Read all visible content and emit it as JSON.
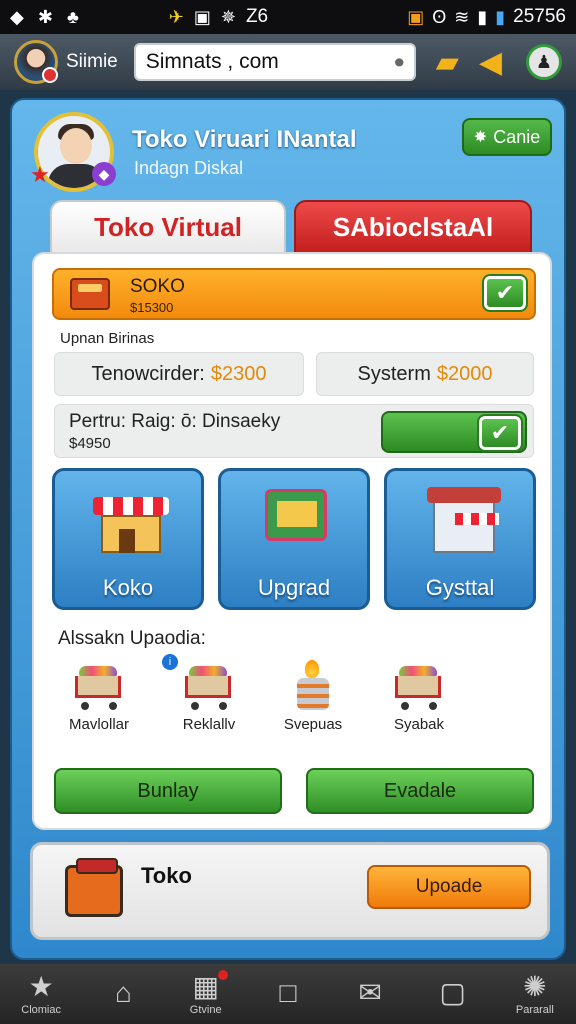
{
  "status_bar": {
    "left_icons": [
      "app-icon",
      "gear-icon",
      "clover-icon"
    ],
    "network": "Z6",
    "time": "25756"
  },
  "header": {
    "app_name": "Siimie",
    "search_value": "Simnats , com"
  },
  "profile": {
    "title": "Toko Viruari INantal",
    "subtitle": "Indagn Diskal",
    "close_label": "Canie"
  },
  "tabs": [
    {
      "label": "Toko Virtual"
    },
    {
      "label": "SAbioclstaAl"
    }
  ],
  "promo": {
    "title": "SOKO",
    "price": "$15300"
  },
  "section_label": "Upnan Birinas",
  "prices": [
    {
      "label": "Tenowcirder:",
      "amount": "$2300"
    },
    {
      "label": "Systerm",
      "amount": "$2000"
    }
  ],
  "wide_row": {
    "title": "Pertru: Raig: ō: Dinsaeky",
    "price": "$4950"
  },
  "tiles": [
    {
      "label": "Koko"
    },
    {
      "label": "Upgrad"
    },
    {
      "label": "Gysttal"
    }
  ],
  "recommendations": {
    "label": "Alssakn Upaodia:",
    "items": [
      {
        "label": "Mavlollar"
      },
      {
        "label": "Reklallv"
      },
      {
        "label": "Svepuas"
      },
      {
        "label": "Syabak"
      }
    ]
  },
  "action_buttons": [
    {
      "label": "Bunlay"
    },
    {
      "label": "Evadale"
    }
  ],
  "bottom_card": {
    "title": "Toko",
    "button_label": "Upoade"
  },
  "nav": [
    {
      "label": "Clomiac"
    },
    {
      "label": ""
    },
    {
      "label": "Gtvine"
    },
    {
      "label": ""
    },
    {
      "label": ""
    },
    {
      "label": ""
    },
    {
      "label": "Pararall"
    }
  ],
  "colors": {
    "accent_blue": "#3a92d4",
    "tab_red": "#d02323",
    "price_orange": "#e38a08",
    "button_green": "#3c9f31"
  }
}
